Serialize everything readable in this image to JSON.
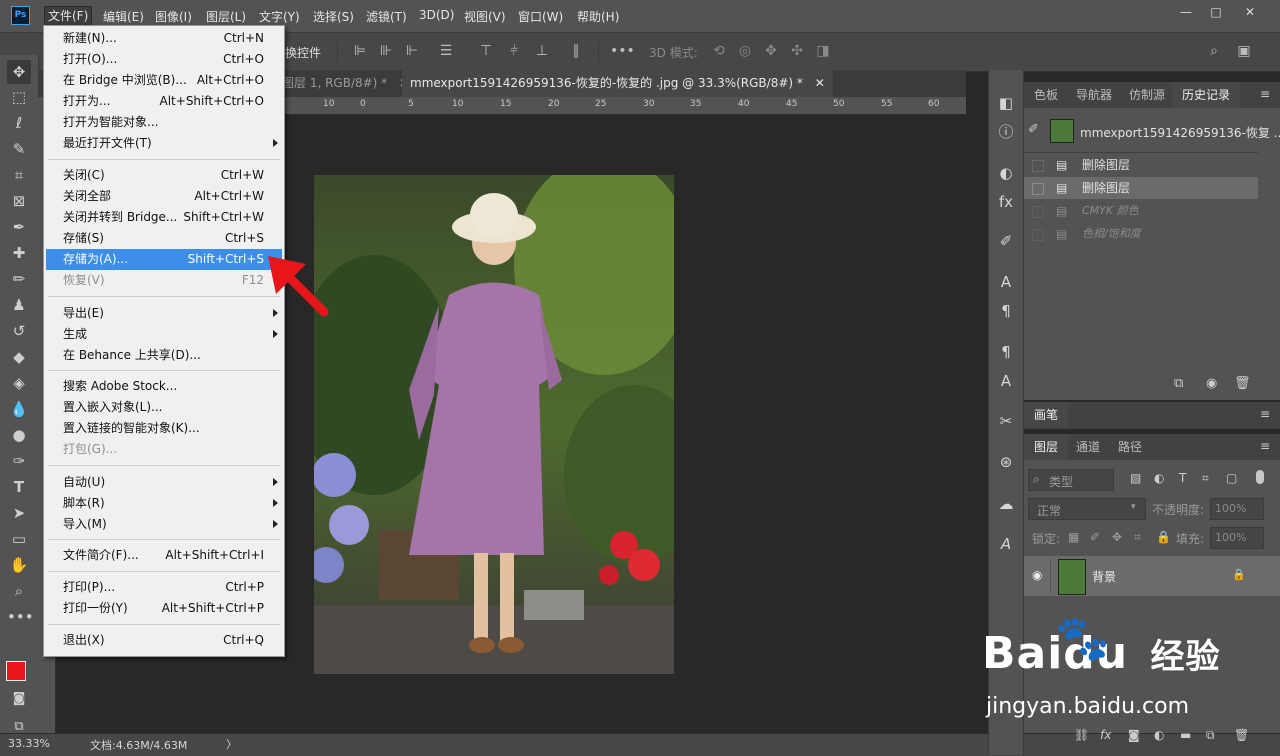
{
  "app": {
    "logo": "Ps"
  },
  "menubar": {
    "items": [
      "文件(F)",
      "编辑(E)",
      "图像(I)",
      "图层(L)",
      "文字(Y)",
      "选择(S)",
      "滤镜(T)",
      "3D(D)",
      "视图(V)",
      "窗口(W)",
      "帮助(H)"
    ],
    "window_controls": [
      "—",
      "□",
      "✕"
    ]
  },
  "options_bar": {
    "label": "换控件",
    "mode_3d": "3D 模式:"
  },
  "tabs": [
    {
      "label": "图层 1, RGB/8#) *",
      "close": "✕"
    },
    {
      "label": "mmexport1591426959136-恢复的-恢复的 .jpg @ 33.3%(RGB/8#) *",
      "close": "✕"
    }
  ],
  "ruler_ticks": [
    "10",
    "0",
    "5",
    "10",
    "15",
    "20",
    "25",
    "30",
    "35",
    "40",
    "45",
    "50",
    "55",
    "60",
    "65"
  ],
  "file_menu": {
    "groups": [
      [
        {
          "label": "新建(N)...",
          "shortcut": "Ctrl+N"
        },
        {
          "label": "打开(O)...",
          "shortcut": "Ctrl+O"
        },
        {
          "label": "在 Bridge 中浏览(B)...",
          "shortcut": "Alt+Ctrl+O"
        },
        {
          "label": "打开为...",
          "shortcut": "Alt+Shift+Ctrl+O"
        },
        {
          "label": "打开为智能对象...",
          "shortcut": ""
        },
        {
          "label": "最近打开文件(T)",
          "shortcut": "",
          "submenu": true
        }
      ],
      [
        {
          "label": "关闭(C)",
          "shortcut": "Ctrl+W"
        },
        {
          "label": "关闭全部",
          "shortcut": "Alt+Ctrl+W"
        },
        {
          "label": "关闭并转到 Bridge...",
          "shortcut": "Shift+Ctrl+W"
        },
        {
          "label": "存储(S)",
          "shortcut": "Ctrl+S"
        },
        {
          "label": "存储为(A)...",
          "shortcut": "Shift+Ctrl+S",
          "selected": true
        },
        {
          "label": "恢复(V)",
          "shortcut": "F12",
          "disabled": true
        }
      ],
      [
        {
          "label": "导出(E)",
          "shortcut": "",
          "submenu": true
        },
        {
          "label": "生成",
          "shortcut": "",
          "submenu": true
        },
        {
          "label": "在 Behance 上共享(D)...",
          "shortcut": ""
        }
      ],
      [
        {
          "label": "搜索 Adobe Stock...",
          "shortcut": ""
        },
        {
          "label": "置入嵌入对象(L)...",
          "shortcut": ""
        },
        {
          "label": "置入链接的智能对象(K)...",
          "shortcut": ""
        },
        {
          "label": "打包(G)...",
          "shortcut": "",
          "disabled": true
        }
      ],
      [
        {
          "label": "自动(U)",
          "shortcut": "",
          "submenu": true
        },
        {
          "label": "脚本(R)",
          "shortcut": "",
          "submenu": true
        },
        {
          "label": "导入(M)",
          "shortcut": "",
          "submenu": true
        }
      ],
      [
        {
          "label": "文件简介(F)...",
          "shortcut": "Alt+Shift+Ctrl+I"
        }
      ],
      [
        {
          "label": "打印(P)...",
          "shortcut": "Ctrl+P"
        },
        {
          "label": "打印一份(Y)",
          "shortcut": "Alt+Shift+Ctrl+P"
        }
      ],
      [
        {
          "label": "退出(X)",
          "shortcut": "Ctrl+Q"
        }
      ]
    ]
  },
  "history_panel": {
    "tabs": [
      "色板",
      "导航器",
      "仿制源",
      "历史记录"
    ],
    "snapshot": "mmexport1591426959136-恢复 ...",
    "states": [
      {
        "label": "删除图层",
        "dim": false
      },
      {
        "label": "删除图层",
        "dim": false,
        "current": true
      },
      {
        "label": "CMYK 颜色",
        "dim": true
      },
      {
        "label": "色相/饱和度",
        "dim": true
      }
    ]
  },
  "brush_panel": {
    "title": "画笔"
  },
  "layers_panel": {
    "tabs": [
      "图层",
      "通道",
      "路径"
    ],
    "filter": "类型",
    "blend_mode": "正常",
    "opacity_label": "不透明度:",
    "opacity_value": "100%",
    "lock_label": "锁定:",
    "fill_label": "填充:",
    "fill_value": "100%",
    "layer_name": "背景"
  },
  "status": {
    "zoom": "33.33%",
    "doc": "文档:4.63M/4.63M"
  },
  "watermark": {
    "brand": "Baidu",
    "brand_cn": "经验",
    "url": "jingyan.baidu.com"
  },
  "colors": {
    "accent": "#3d8ee8",
    "arrow": "#e8161a",
    "foreground": "#e8161a",
    "background": "#ffffff"
  }
}
